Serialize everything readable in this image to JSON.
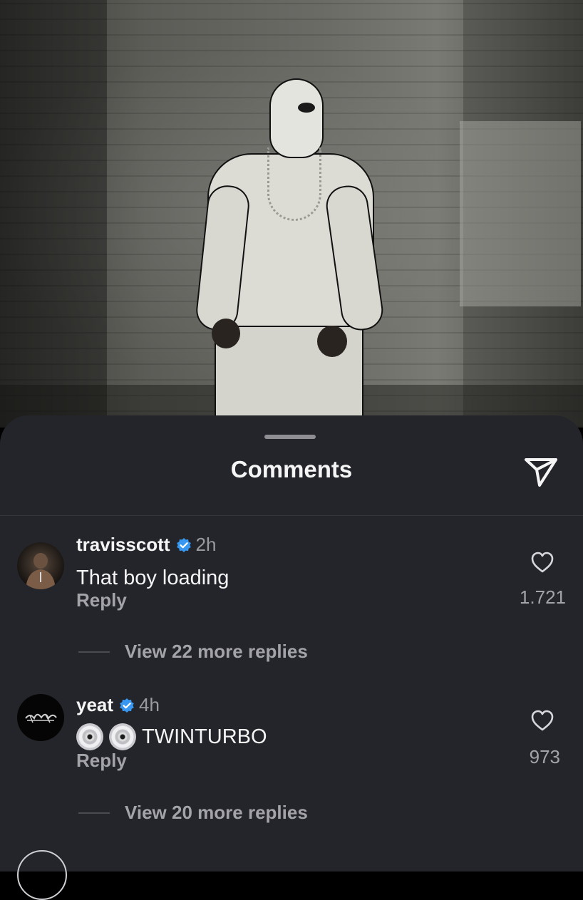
{
  "sheet": {
    "title": "Comments"
  },
  "comments": [
    {
      "username": "travisscott",
      "verified": true,
      "time": "2h",
      "text": "That boy loading",
      "reply_label": "Reply",
      "likes": "1.721",
      "more_replies": "View 22 more replies"
    },
    {
      "username": "yeat",
      "verified": true,
      "time": "4h",
      "text": "TWINTURBO",
      "emoji_prefix": [
        "cd-emoji",
        "cd-emoji"
      ],
      "reply_label": "Reply",
      "likes": "973",
      "more_replies": "View 20 more replies"
    }
  ],
  "colors": {
    "sheet_bg": "#24252b",
    "verified_badge": "#3897f0",
    "muted_text": "#a3a3a8"
  },
  "icons": [
    "share-icon",
    "verified-badge-icon",
    "heart-icon",
    "cd-emoji"
  ]
}
